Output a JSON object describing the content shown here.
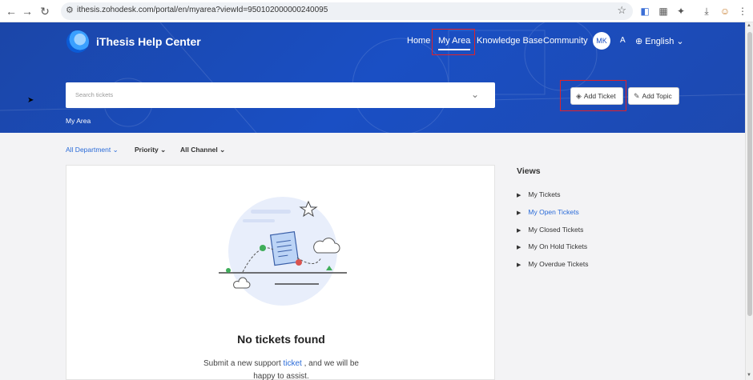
{
  "browser": {
    "url": "ithesis.zohodesk.com/portal/en/myarea?viewId=950102000000240095"
  },
  "header": {
    "brand": "iThesis Help Center",
    "nav": [
      "Home",
      "My Area",
      "Knowledge Base",
      "Community"
    ],
    "active_nav": "My Area",
    "avatar_initials": "MK",
    "font_toggle": "A",
    "language": "English"
  },
  "hero": {
    "search_placeholder": "Search tickets",
    "add_ticket_label": "Add Ticket",
    "add_topic_label": "Add Topic",
    "breadcrumb": "My Area"
  },
  "filters": {
    "department": "All Department",
    "priority": "Priority",
    "channel": "All Channel"
  },
  "empty_state": {
    "title": "No tickets found",
    "sub_before": "Submit a new support",
    "sub_link": "ticket",
    "sub_after": ", and we will be happy to assist."
  },
  "views": {
    "title": "Views",
    "items": [
      "My Tickets",
      "My Open Tickets",
      "My Closed Tickets",
      "My On Hold Tickets",
      "My Overdue Tickets"
    ],
    "active_index": 1
  },
  "colors": {
    "hero_blue": "#1a4fc4",
    "accent_link": "#2a6bd8",
    "highlight_red": "#e0222a"
  }
}
